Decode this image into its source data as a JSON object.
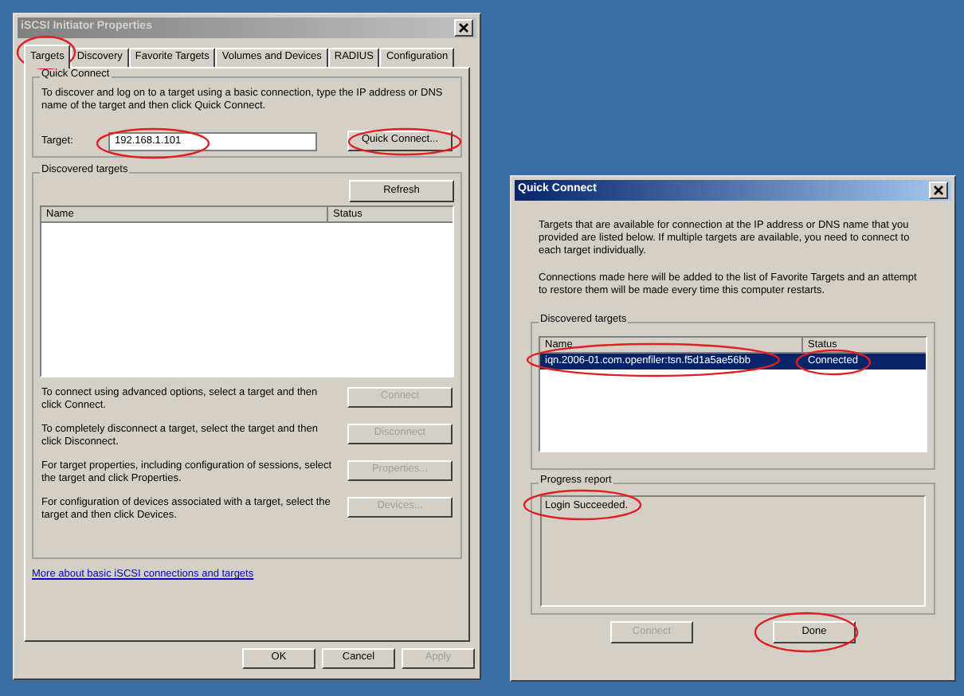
{
  "properties_window": {
    "title": "iSCSI Initiator Properties",
    "tabs": [
      {
        "label": "Targets",
        "selected": true
      },
      {
        "label": "Discovery",
        "selected": false
      },
      {
        "label": "Favorite Targets",
        "selected": false
      },
      {
        "label": "Volumes and Devices",
        "selected": false
      },
      {
        "label": "RADIUS",
        "selected": false
      },
      {
        "label": "Configuration",
        "selected": false
      }
    ],
    "quick_connect": {
      "legend": "Quick Connect",
      "description": "To discover and log on to a target using a basic connection, type the IP address or DNS name of the target and then click Quick Connect.",
      "target_label": "Target:",
      "target_value": "192.168.1.101",
      "button": "Quick Connect..."
    },
    "discovered_targets": {
      "legend": "Discovered targets",
      "refresh": "Refresh",
      "columns": [
        "Name",
        "Status"
      ]
    },
    "actions": [
      {
        "text": "To connect using advanced options, select a target and then click Connect.",
        "button": "Connect",
        "disabled": true
      },
      {
        "text": "To completely disconnect a target, select the target and then click Disconnect.",
        "button": "Disconnect",
        "disabled": true
      },
      {
        "text": "For target properties, including configuration of sessions, select the target and click Properties.",
        "button": "Properties...",
        "disabled": true
      },
      {
        "text": "For configuration of devices associated with a target, select the target and then click Devices.",
        "button": "Devices...",
        "disabled": true
      }
    ],
    "link": "More about basic iSCSI connections and targets",
    "buttons": [
      {
        "label": "OK",
        "disabled": false
      },
      {
        "label": "Cancel",
        "disabled": false
      },
      {
        "label": "Apply",
        "disabled": true
      }
    ]
  },
  "quick_connect_window": {
    "title": "Quick Connect",
    "paragraphs": [
      "Targets that are available for connection at the IP address or DNS name that you provided are listed below.  If multiple targets are available, you need to connect to each target individually.",
      "Connections made here will be added to the list of Favorite Targets and an attempt to restore them will be made every time this computer restarts."
    ],
    "discovered_targets": {
      "legend": "Discovered targets",
      "columns": [
        "Name",
        "Status"
      ],
      "rows": [
        {
          "name": "iqn.2006-01.com.openfiler:tsn.f5d1a5ae56bb",
          "status": "Connected",
          "selected": true
        }
      ]
    },
    "progress": {
      "legend": "Progress report",
      "text": "Login Succeeded."
    },
    "buttons": [
      {
        "label": "Connect",
        "disabled": true
      },
      {
        "label": "Done",
        "disabled": false
      }
    ]
  }
}
